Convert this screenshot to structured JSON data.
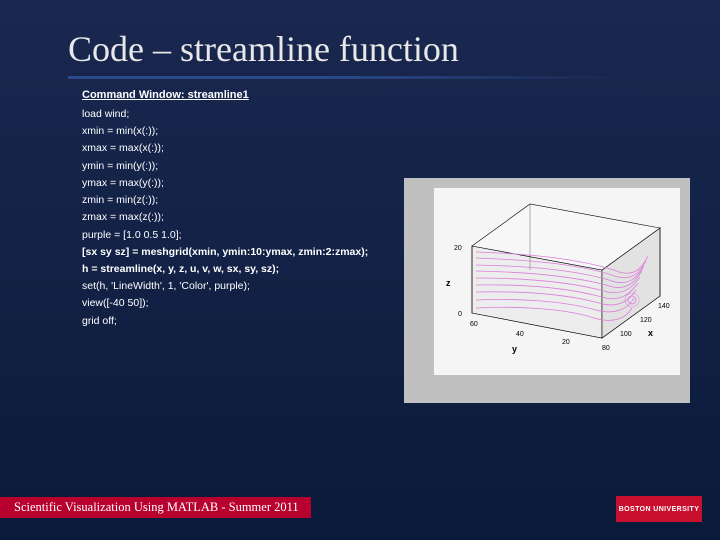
{
  "title": "Code – streamline function",
  "command_header": "Command Window: streamline1",
  "code": [
    {
      "text": "load wind;",
      "bold": false
    },
    {
      "text": "xmin = min(x(:));",
      "bold": false
    },
    {
      "text": "xmax = max(x(:));",
      "bold": false
    },
    {
      "text": "ymin = min(y(:));",
      "bold": false
    },
    {
      "text": "ymax = max(y(:));",
      "bold": false
    },
    {
      "text": "zmin = min(z(:));",
      "bold": false
    },
    {
      "text": "zmax = max(z(:));",
      "bold": false
    },
    {
      "text": "purple = [1.0 0.5 1.0];",
      "bold": false
    },
    {
      "text": "[sx sy sz] = meshgrid(xmin, ymin:10:ymax, zmin:2:zmax);",
      "bold": true
    },
    {
      "text": "h = streamline(x, y, z, u, v, w, sx, sy, sz);",
      "bold": true
    },
    {
      "text": "set(h, 'LineWidth', 1, 'Color', purple);",
      "bold": false
    },
    {
      "text": "view([-40 50]);",
      "bold": false
    },
    {
      "text": "grid off;",
      "bold": false
    }
  ],
  "footer": "Scientific Visualization Using MATLAB - Summer 2011",
  "logo_text": "BOSTON\nUNIVERSITY",
  "chart_data": {
    "type": "streamline3d",
    "title": "",
    "x_range": [
      80,
      140
    ],
    "y_range": [
      10,
      60
    ],
    "z_range": [
      0,
      20
    ],
    "x_ticks": [
      80,
      100,
      120,
      140
    ],
    "y_ticks": [
      20,
      40,
      60
    ],
    "z_ticks": [
      0,
      20
    ],
    "view": [
      -40,
      50
    ],
    "grid": false,
    "streamlines": {
      "color": "#d97fd9",
      "linewidth": 1,
      "description": "purple streamlines flowing across the xy extent, curling near x≈120 y≈50"
    }
  }
}
